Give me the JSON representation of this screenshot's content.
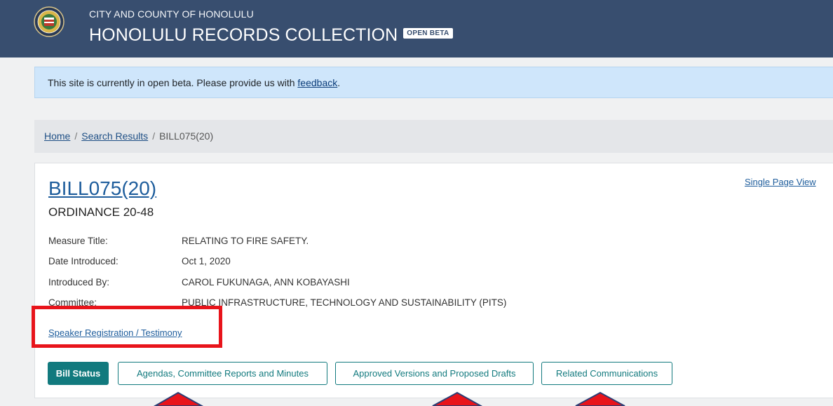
{
  "header": {
    "subtitle": "CITY AND COUNTY OF HONOLULU",
    "title": "HONOLULU RECORDS COLLECTION",
    "badge": "OPEN BETA"
  },
  "alert": {
    "text": "This site is currently in open beta. Please provide us with ",
    "link": "feedback",
    "end": "."
  },
  "breadcrumb": {
    "home": "Home",
    "search": "Search Results",
    "current": "BILL075(20)",
    "separator": "/"
  },
  "bill": {
    "title": "BILL075(20)",
    "ordinance": "ORDINANCE 20-48",
    "single_page_view": "Single Page View",
    "fields": [
      {
        "label": "Measure Title:",
        "value": "RELATING TO FIRE SAFETY."
      },
      {
        "label": "Date Introduced:",
        "value": "Oct 1, 2020"
      },
      {
        "label": "Introduced By:",
        "value": "CAROL FUKUNAGA, ANN KOBAYASHI"
      },
      {
        "label": "Committee:",
        "value": "PUBLIC INFRASTRUCTURE, TECHNOLOGY AND SUSTAINABILITY (PITS)"
      }
    ],
    "speaker_link": "Speaker Registration / Testimony"
  },
  "tabs": {
    "bill_status": "Bill Status",
    "agendas": "Agendas, Committee Reports and Minutes",
    "versions": "Approved Versions and Proposed Drafts",
    "communications": "Related Communications"
  },
  "colors": {
    "header": "#384e6f",
    "accent": "#127a7e",
    "highlight": "#e8141b"
  }
}
